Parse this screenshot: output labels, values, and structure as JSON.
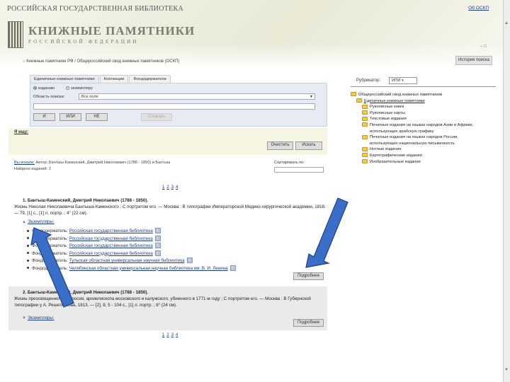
{
  "header": {
    "library_name": "РОССИЙСКАЯ ГОСУДАРСТВЕННАЯ БИБЛИОТЕКА",
    "about_link": "Об ОСКП",
    "logo_title": "КНИЖНЫЕ ПАМЯТНИКИ",
    "logo_sub": "РОССИЙСКОЙ ФЕДЕРАЦИИ",
    "minimize": "– □",
    "breadcrumb_home": "⌂",
    "breadcrumb": "Книжные памятники РФ / Общероссийский свод книжных памятников (ОСКП)",
    "classic_button": "История поиска"
  },
  "search": {
    "tabs": [
      "Единичные книжные памятники",
      "Коллекции",
      "Фондодержатели"
    ],
    "radio_options": [
      "изданию",
      "экземпляру"
    ],
    "area_label": "Область поиска:",
    "area_value": "Все поля",
    "and": "И",
    "or": "ИЛИ",
    "not": "НЕ",
    "dictionary": "Словарь"
  },
  "query": {
    "label": "Я ищу:",
    "clear": "Очистить",
    "find": "Искать"
  },
  "results": {
    "you_chose_label": "Вы искали:",
    "you_chose_text": "Автор: Бантыш-Каменский, Дмитрий Николаевич (1788 - 1850) и Бантыш",
    "found_label": "Найдено изданий:",
    "found_value": "2",
    "sort_label": "Сортировать по:",
    "pages": [
      "1",
      "2",
      "3",
      "4"
    ]
  },
  "record1": {
    "title": "1. Бантыш-Каменский, Дмитрий Николаевич (1788 - 1850).",
    "body": "Жизнь Николая Николаевича Бантыша-Каменского : С портретом его. — Москва : В типографии Императорской Медико-хирургической академии, 1818. — 79, [1] с., [1] л. портр. ; 4° (22 см).",
    "copies": "Экземпляры:",
    "holdings": [
      {
        "label": "Фондодержатель:",
        "lib": "Российская государственная библиотека"
      },
      {
        "label": "Фондодержатель:",
        "lib": "Российская государственная библиотека"
      },
      {
        "label": "Фондодержатель:",
        "lib": "Российская государственная библиотека"
      },
      {
        "label": "Фондодержатель:",
        "lib": "Российская государственная библиотека"
      },
      {
        "label": "Фондодержатель:",
        "lib": "Тульская областная универсальная научная библиотека"
      },
      {
        "label": "Фондодержатель:",
        "lib": "Челябинская областная универсальная научная библиотека им. В. И. Ленина"
      }
    ],
    "info_icon": "i",
    "more": "Подробнее"
  },
  "record2": {
    "title": "2. Бантыш-Каменский, Дмитрий Николаевич (1788 - 1850).",
    "body": "Жизнь преосвященного Амвросия, архиепископа московского и калужского, убиенного в 1771-м году ; С портретом его. — Москва : В Губернской типографии у А. Решетникова, 1813. — [2], 8, 5 - 104 с., [1] л. портр. ; 8° (24 см).",
    "copies": "Экземпляры:",
    "more": "Подробнее"
  },
  "rubricator": {
    "label": "Рубрикатор:",
    "selected": "ИПИ",
    "nodes": [
      {
        "text": "Общероссийский свод книжных памятников",
        "level": 0
      },
      {
        "text": "Единичные книжные памятники",
        "level": 1,
        "selected": true
      },
      {
        "text": "Рукописные книги",
        "level": 2
      },
      {
        "text": "Рукописные карты",
        "level": 2
      },
      {
        "text": "Текстовые издания",
        "level": 2
      },
      {
        "text": "Печатные издания на языках народов Азии и Африки,",
        "level": 2
      },
      {
        "text": "использующих арабскую графику",
        "level": 2,
        "cont": true
      },
      {
        "text": "Печатные издания на языках народов России,",
        "level": 2
      },
      {
        "text": "использующих национальную письменность",
        "level": 2,
        "cont": true
      },
      {
        "text": "Нотные издания",
        "level": 2
      },
      {
        "text": "Картографические издания",
        "level": 2
      },
      {
        "text": "Изобразительные издания",
        "level": 2
      }
    ]
  },
  "colors": {
    "arrow_fill": "#3a6fc9",
    "arrow_stroke": "#1d3f82",
    "panel_bg": "#e6ebf4"
  }
}
